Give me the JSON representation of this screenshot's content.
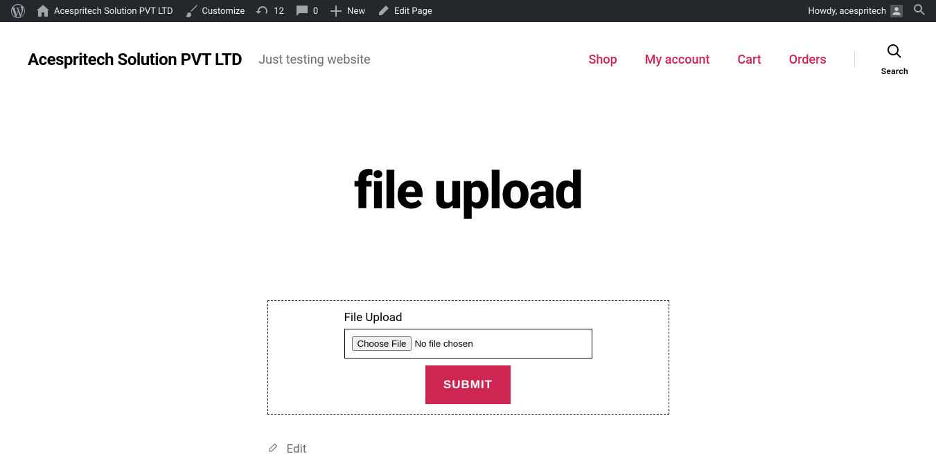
{
  "adminbar": {
    "site_name": "Acespritech Solution PVT LTD",
    "customize": "Customize",
    "updates_count": "12",
    "comments_count": "0",
    "new_label": "New",
    "edit_page": "Edit Page",
    "howdy": "Howdy, acespritech"
  },
  "header": {
    "title": "Acespritech Solution PVT LTD",
    "tagline": "Just testing website",
    "nav": {
      "shop": "Shop",
      "account": "My account",
      "cart": "Cart",
      "orders": "Orders"
    },
    "search_label": "Search"
  },
  "page": {
    "title": "file upload",
    "form_label": "File Upload",
    "file_status": "No file chosen",
    "submit": "SUBMIT",
    "edit_label": "Edit"
  }
}
